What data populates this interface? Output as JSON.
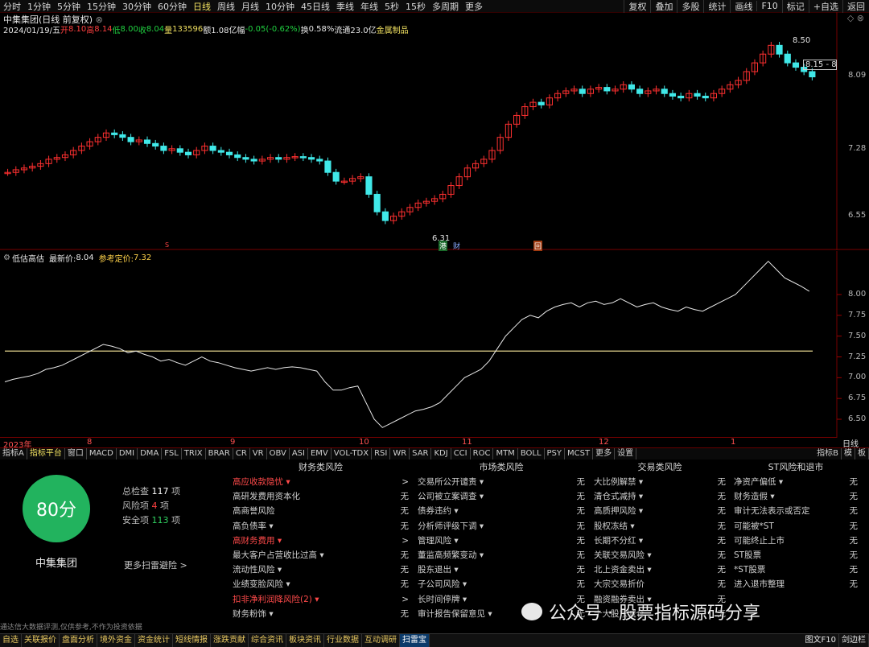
{
  "toolbar": {
    "left": [
      "分时",
      "1分钟",
      "5分钟",
      "15分钟",
      "30分钟",
      "60分钟",
      "日线",
      "周线",
      "月线",
      "10分钟",
      "45日线",
      "季线",
      "年线",
      "5秒",
      "15秒",
      "多周期",
      "更多"
    ],
    "active": "日线",
    "right": [
      "复权",
      "叠加",
      "多股",
      "统计",
      "画线",
      "F10",
      "标记",
      "+自选",
      "返回"
    ]
  },
  "header": {
    "title": "中集集团(日线 前复权)",
    "date": "2024/01/19/五",
    "open_label": "开",
    "open": "8.10",
    "high_label": "高",
    "high": "8.14",
    "low_label": "低",
    "low": "8.00",
    "close_label": "收",
    "close": "8.04",
    "vol_label": "量",
    "vol": "133596",
    "amt_label": "额",
    "amt": "1.08亿",
    "chg_label": "幅",
    "chg": "-0.05(-0.62%)",
    "turn_label": "换",
    "turn": "0.58%",
    "float_label": "流通",
    "float": "23.0亿",
    "sector": "金属制品"
  },
  "main_axis": [
    "8.09",
    "7.28",
    "6.55"
  ],
  "main_annotations": {
    "high": "8.50",
    "low": "6.31",
    "price_range": "8.15 - 8.1",
    "tag_gang": "港",
    "tag_cai": "财",
    "tag_hui": "回",
    "tag_s": "S"
  },
  "indicator": {
    "name": "低估高估",
    "latest_label": "最新价:",
    "latest": "8.04",
    "ref_label": "参考定价:",
    "ref": "7.32",
    "axis": [
      "8.00",
      "7.75",
      "7.50",
      "7.25",
      "7.00",
      "6.75",
      "6.50"
    ]
  },
  "months": [
    "2023年",
    "8",
    "9",
    "10",
    "11",
    "12",
    "1"
  ],
  "period_label": "日线",
  "tabs": [
    "指标A",
    "指标平台",
    "窗口",
    "MACD",
    "DMI",
    "DMA",
    "FSL",
    "TRIX",
    "BRAR",
    "CR",
    "VR",
    "OBV",
    "ASI",
    "EMV",
    "VOL-TDX",
    "RSI",
    "WR",
    "SAR",
    "KDJ",
    "CCI",
    "ROC",
    "MTM",
    "BOLL",
    "PSY",
    "MCST",
    "更多",
    "设置"
  ],
  "tabs_right": [
    "指标B",
    "模",
    "板"
  ],
  "score": {
    "value": "80分",
    "name": "中集集团",
    "total_label": "总检查",
    "total": "117",
    "total_unit": "项",
    "risk_label": "风险项",
    "risk": "4",
    "risk_unit": "项",
    "safe_label": "安全项",
    "safe": "113",
    "safe_unit": "项",
    "more": "更多扫雷避险 >",
    "disclaimer": "通达信大数据评测,仅供参考,不作为投资依据"
  },
  "columns": [
    {
      "title": "财务类风险",
      "rows": [
        {
          "label": "高应收款隐忧 ▾",
          "status": ">",
          "hi": true
        },
        {
          "label": "高研发费用资本化",
          "status": "无"
        },
        {
          "label": "高商誉风险",
          "status": "无"
        },
        {
          "label": "高负债率 ▾",
          "status": "无"
        },
        {
          "label": "高财务费用 ▾",
          "status": ">",
          "hi": true
        },
        {
          "label": "最大客户占营收比过高 ▾",
          "status": "无"
        },
        {
          "label": "流动性风险 ▾",
          "status": "无"
        },
        {
          "label": "业绩变脸风险 ▾",
          "status": "无"
        },
        {
          "label": "扣非净利润降风险(2) ▾",
          "status": ">",
          "hi": true
        },
        {
          "label": "财务粉饰 ▾",
          "status": "无"
        }
      ]
    },
    {
      "title": "市场类风险",
      "rows": [
        {
          "label": "交易所公开谴责 ▾",
          "status": "无"
        },
        {
          "label": "公司被立案调查 ▾",
          "status": "无"
        },
        {
          "label": "债券违约 ▾",
          "status": "无"
        },
        {
          "label": "分析师评级下调 ▾",
          "status": "无"
        },
        {
          "label": "管理风险 ▾",
          "status": "无"
        },
        {
          "label": "董监高频繁变动 ▾",
          "status": "无"
        },
        {
          "label": "股东退出 ▾",
          "status": "无"
        },
        {
          "label": "子公司风险 ▾",
          "status": "无"
        },
        {
          "label": "长时间停牌 ▾",
          "status": "无"
        },
        {
          "label": "审计报告保留意见 ▾",
          "status": "无"
        }
      ]
    },
    {
      "title": "交易类风险",
      "rows": [
        {
          "label": "大比例解禁 ▾",
          "status": "无"
        },
        {
          "label": "清仓式减持 ▾",
          "status": "无"
        },
        {
          "label": "高质押风险 ▾",
          "status": "无"
        },
        {
          "label": "股权冻结 ▾",
          "status": "无"
        },
        {
          "label": "长期不分红 ▾",
          "status": "无"
        },
        {
          "label": "关联交易风险 ▾",
          "status": "无"
        },
        {
          "label": "北上资金卖出 ▾",
          "status": "无"
        },
        {
          "label": "大宗交易折价",
          "status": "无"
        },
        {
          "label": "融资融券卖出 ▾",
          "status": "无"
        },
        {
          "label": "十大股东减仓",
          "status": "无"
        }
      ]
    },
    {
      "title": "ST风险和退市",
      "rows": [
        {
          "label": "净资产偏低 ▾",
          "status": "无"
        },
        {
          "label": "财务造假 ▾",
          "status": "无"
        },
        {
          "label": "审计无法表示或否定",
          "status": "无"
        },
        {
          "label": "可能被*ST",
          "status": "无"
        },
        {
          "label": "可能终止上市",
          "status": "无"
        },
        {
          "label": "ST股票",
          "status": "无"
        },
        {
          "label": "*ST股票",
          "status": "无"
        },
        {
          "label": "进入退市整理",
          "status": "无"
        }
      ]
    }
  ],
  "watermark": "公众号 · 股票指标源码分享",
  "bottom": [
    "自选",
    "关联报价",
    "盘面分析",
    "境外资金",
    "资金统计",
    "短线情报",
    "涨跌贡献",
    "综合资讯",
    "板块资讯",
    "行业数据",
    "互动调研",
    "扫雷宝"
  ],
  "bottom_active": "扫雷宝",
  "bottom_right": [
    "图文F10",
    "剑边栏"
  ],
  "colors": {
    "up": "#ff3030",
    "down": "#40e8e8",
    "ref_line": "#e8d890",
    "score": "#22b35e"
  }
}
